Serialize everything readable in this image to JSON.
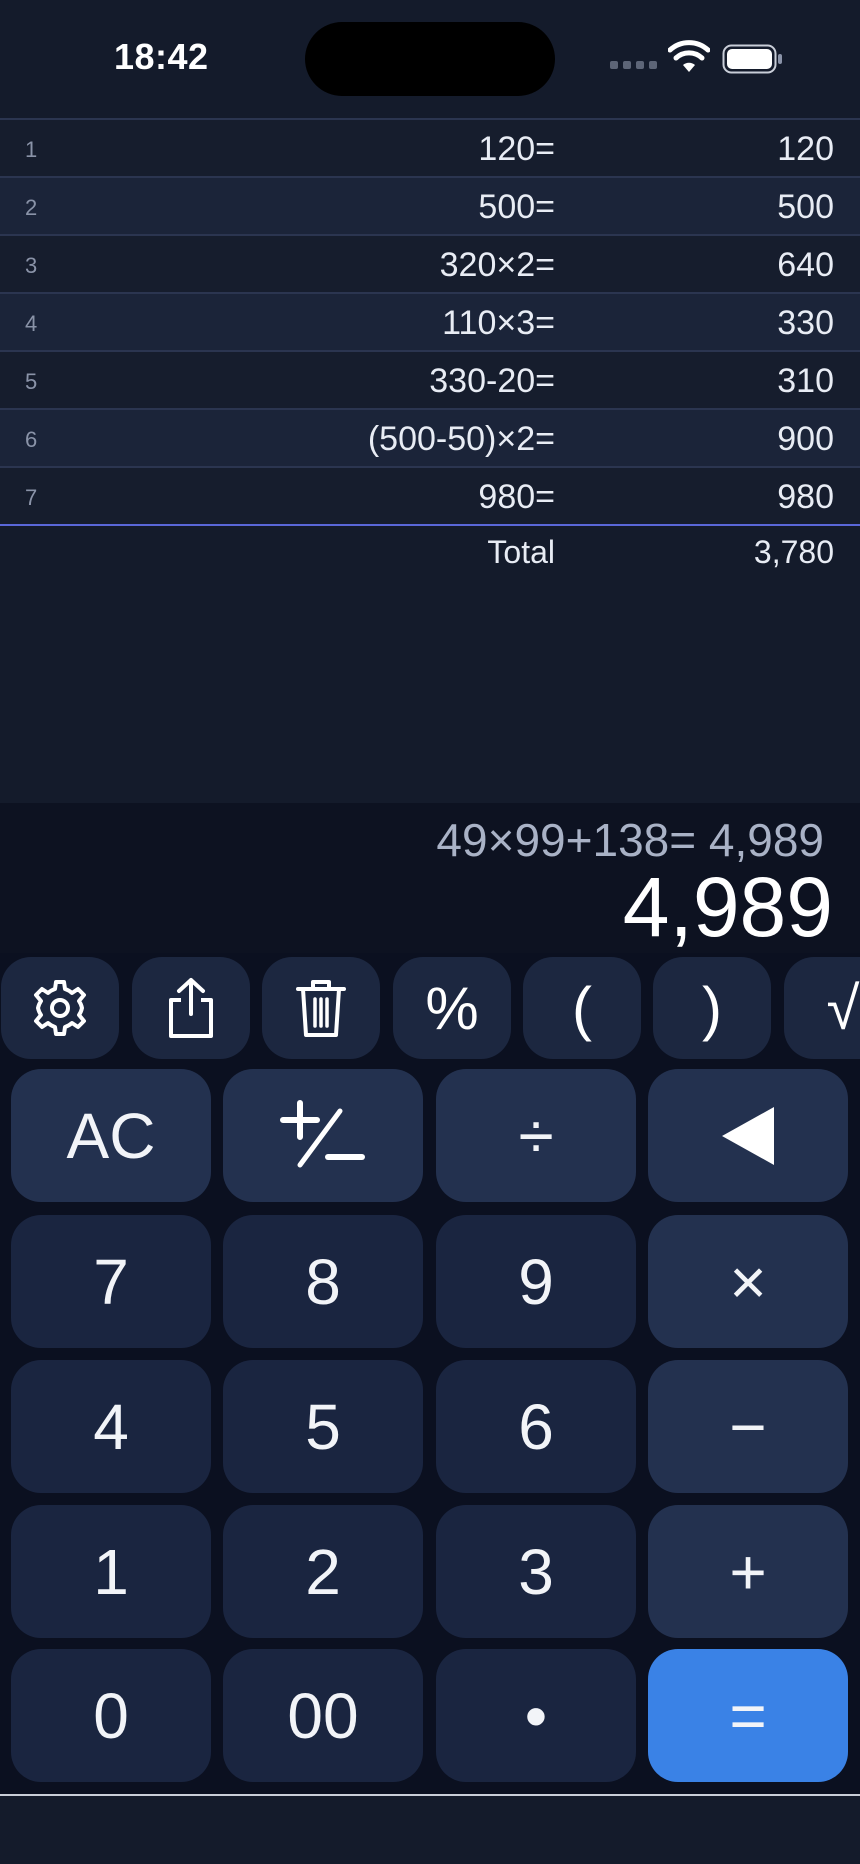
{
  "status_bar": {
    "time": "18:42"
  },
  "history": [
    {
      "index": "1",
      "expression": "120=",
      "result": "120"
    },
    {
      "index": "2",
      "expression": "500=",
      "result": "500"
    },
    {
      "index": "3",
      "expression": "320×2=",
      "result": "640"
    },
    {
      "index": "4",
      "expression": "110×3=",
      "result": "330"
    },
    {
      "index": "5",
      "expression": "330-20=",
      "result": "310"
    },
    {
      "index": "6",
      "expression": "(500-50)×2=",
      "result": "900"
    },
    {
      "index": "7",
      "expression": "980=",
      "result": "980"
    }
  ],
  "total": {
    "label": "Total",
    "value": "3,780"
  },
  "display": {
    "expression": "49×99+138= 4,989",
    "value": "4,989"
  },
  "function_row": [
    {
      "icon": "gear-icon"
    },
    {
      "icon": "share-icon"
    },
    {
      "icon": "trash-icon"
    },
    {
      "label": "%"
    },
    {
      "label": "("
    },
    {
      "label": ")"
    },
    {
      "label": "√"
    }
  ],
  "keys": {
    "ac": "AC",
    "divide": "÷",
    "backspace_icon": "backspace-triangle-icon",
    "seven": "7",
    "eight": "8",
    "nine": "9",
    "multiply": "×",
    "four": "4",
    "five": "5",
    "six": "6",
    "minus": "−",
    "one": "1",
    "two": "2",
    "three": "3",
    "plus": "+",
    "zero": "0",
    "double_zero": "00",
    "decimal": "•",
    "equals": "="
  },
  "colors": {
    "background": "#141b2b",
    "key": "#1a2540",
    "operator_key": "#23314f",
    "equals_key": "#3a82e6",
    "total_divider": "#5a67d8"
  }
}
